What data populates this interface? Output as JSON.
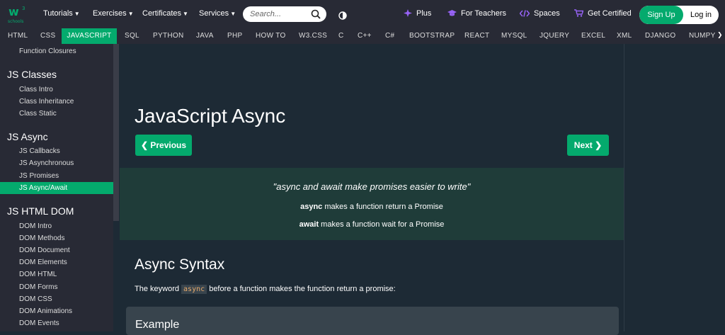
{
  "header": {
    "logo_text": "schools",
    "logo_sup": "3",
    "nav": [
      {
        "label": "Tutorials"
      },
      {
        "label": "Exercises"
      },
      {
        "label": "Certificates"
      },
      {
        "label": "Services"
      }
    ],
    "search": {
      "placeholder": "Search..."
    },
    "tools": [
      {
        "label": "Plus",
        "icon": "diamond-icon"
      },
      {
        "label": "For Teachers",
        "icon": "graduation-cap-icon"
      },
      {
        "label": "Spaces",
        "icon": "code-icon"
      },
      {
        "label": "Get Certified",
        "icon": "cart-icon"
      }
    ],
    "signup": "Sign Up",
    "login": "Log in"
  },
  "techbar": [
    "HTML",
    "CSS",
    "JAVASCRIPT",
    "SQL",
    "PYTHON",
    "JAVA",
    "PHP",
    "HOW TO",
    "W3.CSS",
    "C",
    "C++",
    "C#",
    "BOOTSTRAP",
    "REACT",
    "MYSQL",
    "JQUERY",
    "EXCEL",
    "XML",
    "DJANGO",
    "NUMPY"
  ],
  "sidebar": {
    "top_link": "Function Closures",
    "sections": [
      {
        "title": "JS Classes",
        "items": [
          "Class Intro",
          "Class Inheritance",
          "Class Static"
        ]
      },
      {
        "title": "JS Async",
        "items": [
          "JS Callbacks",
          "JS Asynchronous",
          "JS Promises",
          "JS Async/Await"
        ]
      },
      {
        "title": "JS HTML DOM",
        "items": [
          "DOM Intro",
          "DOM Methods",
          "DOM Document",
          "DOM Elements",
          "DOM HTML",
          "DOM Forms",
          "DOM CSS",
          "DOM Animations",
          "DOM Events"
        ]
      }
    ],
    "active": "JS Async/Await"
  },
  "main": {
    "title": "JavaScript Async",
    "prev": "❮ Previous",
    "next": "Next ❯",
    "quote": "\"async and await make promises easier to write\"",
    "line1_kw": "async",
    "line1_rest": " makes a function return a Promise",
    "line2_kw": "await",
    "line2_rest": " makes a function wait for a Promise",
    "section_title": "Async Syntax",
    "para_before": "The keyword ",
    "para_code": "async",
    "para_after": " before a function makes the function return a promise:",
    "example_label": "Example"
  },
  "colors": {
    "accent": "#04aa6d",
    "bg": "#1d2a35",
    "bar": "#282a35",
    "note": "#1f3c39"
  }
}
